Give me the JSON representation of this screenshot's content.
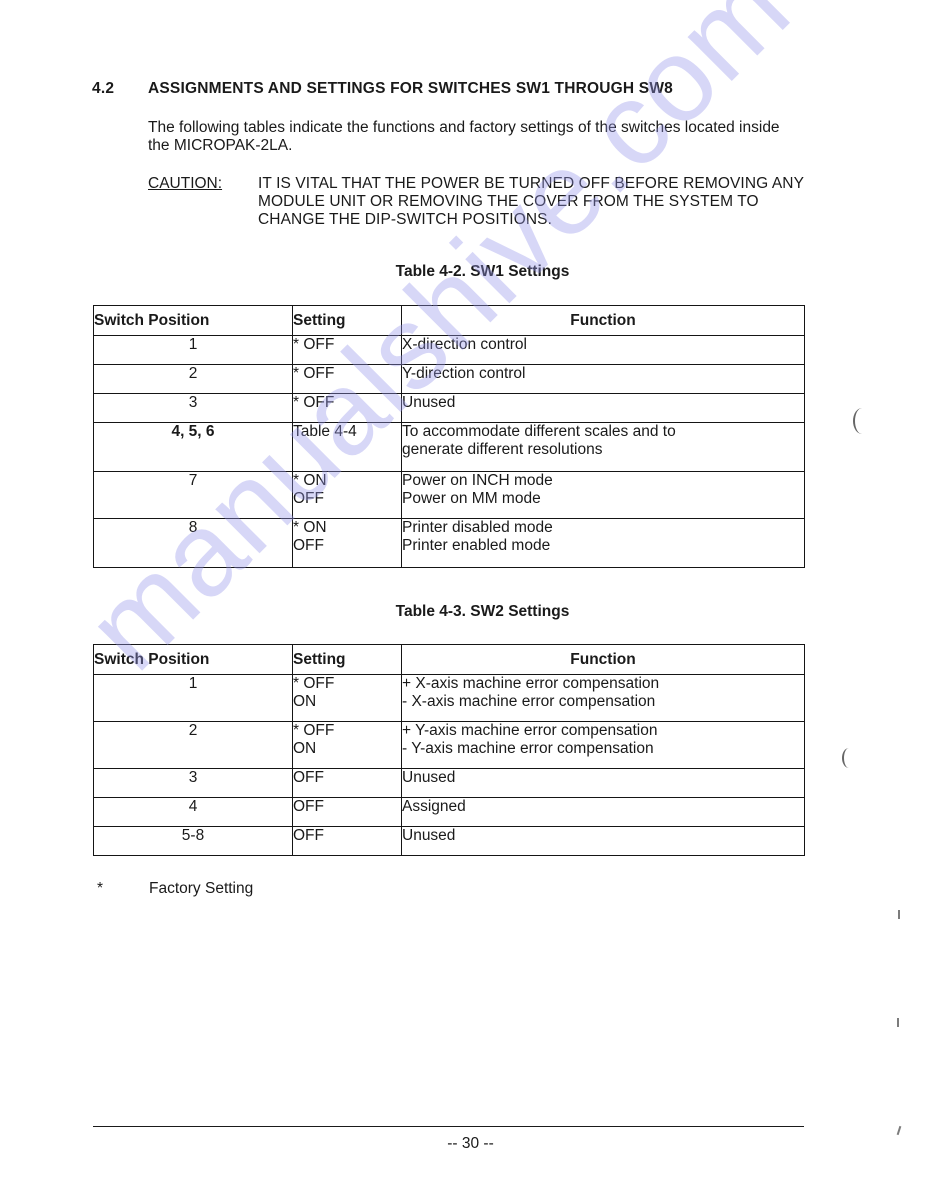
{
  "section": {
    "number": "4.2",
    "title": "ASSIGNMENTS AND SETTINGS FOR SWITCHES SW1 THROUGH SW8",
    "intro": "The following tables indicate the functions and factory settings of the switches located inside the MICROPAK-2LA.",
    "caution_label": "CAUTION:",
    "caution_text": "IT IS VITAL THAT THE POWER BE TURNED OFF BEFORE REMOVING ANY MODULE UNIT OR REMOVING THE COVER FROM THE SYSTEM TO CHANGE THE DIP-SWITCH POSITIONS."
  },
  "tables": [
    {
      "caption": "Table 4-2.  SW1 Settings",
      "headers": [
        "Switch Position",
        "Setting",
        "Function"
      ],
      "rows": [
        {
          "position": "1",
          "setting": [
            "* OFF"
          ],
          "function": [
            "X-direction control"
          ]
        },
        {
          "position": "2",
          "setting": [
            "* OFF"
          ],
          "function": [
            "Y-direction control"
          ]
        },
        {
          "position": "3",
          "setting": [
            "* OFF"
          ],
          "function": [
            "Unused"
          ]
        },
        {
          "position": "4, 5, 6",
          "setting": [
            "Table 4-4"
          ],
          "function": [
            "To accommodate different scales and to",
            "generate different resolutions"
          ]
        },
        {
          "position": "7",
          "setting": [
            "* ON",
            "OFF"
          ],
          "function": [
            "Power on INCH mode",
            "Power on MM mode"
          ]
        },
        {
          "position": "8",
          "setting": [
            "* ON",
            "OFF"
          ],
          "function": [
            "Printer disabled mode",
            "Printer enabled mode"
          ]
        }
      ]
    },
    {
      "caption": "Table 4-3.  SW2 Settings",
      "headers": [
        "Switch Position",
        "Setting",
        "Function"
      ],
      "rows": [
        {
          "position": "1",
          "setting": [
            "* OFF",
            "ON"
          ],
          "function": [
            "+ X-axis machine error compensation",
            "- X-axis machine error compensation"
          ]
        },
        {
          "position": "2",
          "setting": [
            "* OFF",
            "ON"
          ],
          "function": [
            "+ Y-axis machine error compensation",
            "- Y-axis machine error compensation"
          ]
        },
        {
          "position": "3",
          "setting": [
            "OFF"
          ],
          "function": [
            "Unused"
          ]
        },
        {
          "position": "4",
          "setting": [
            "OFF"
          ],
          "function": [
            "Assigned"
          ]
        },
        {
          "position": "5-8",
          "setting": [
            "OFF"
          ],
          "function": [
            "Unused"
          ]
        }
      ]
    }
  ],
  "footnote": {
    "symbol": "*",
    "text": "Factory Setting"
  },
  "footer": {
    "page_number": "-- 30 --"
  },
  "watermark": "manualshive.com",
  "colors": {
    "ink": "#1a1a1a",
    "watermark": "#9696eb",
    "paper": "#ffffff"
  }
}
